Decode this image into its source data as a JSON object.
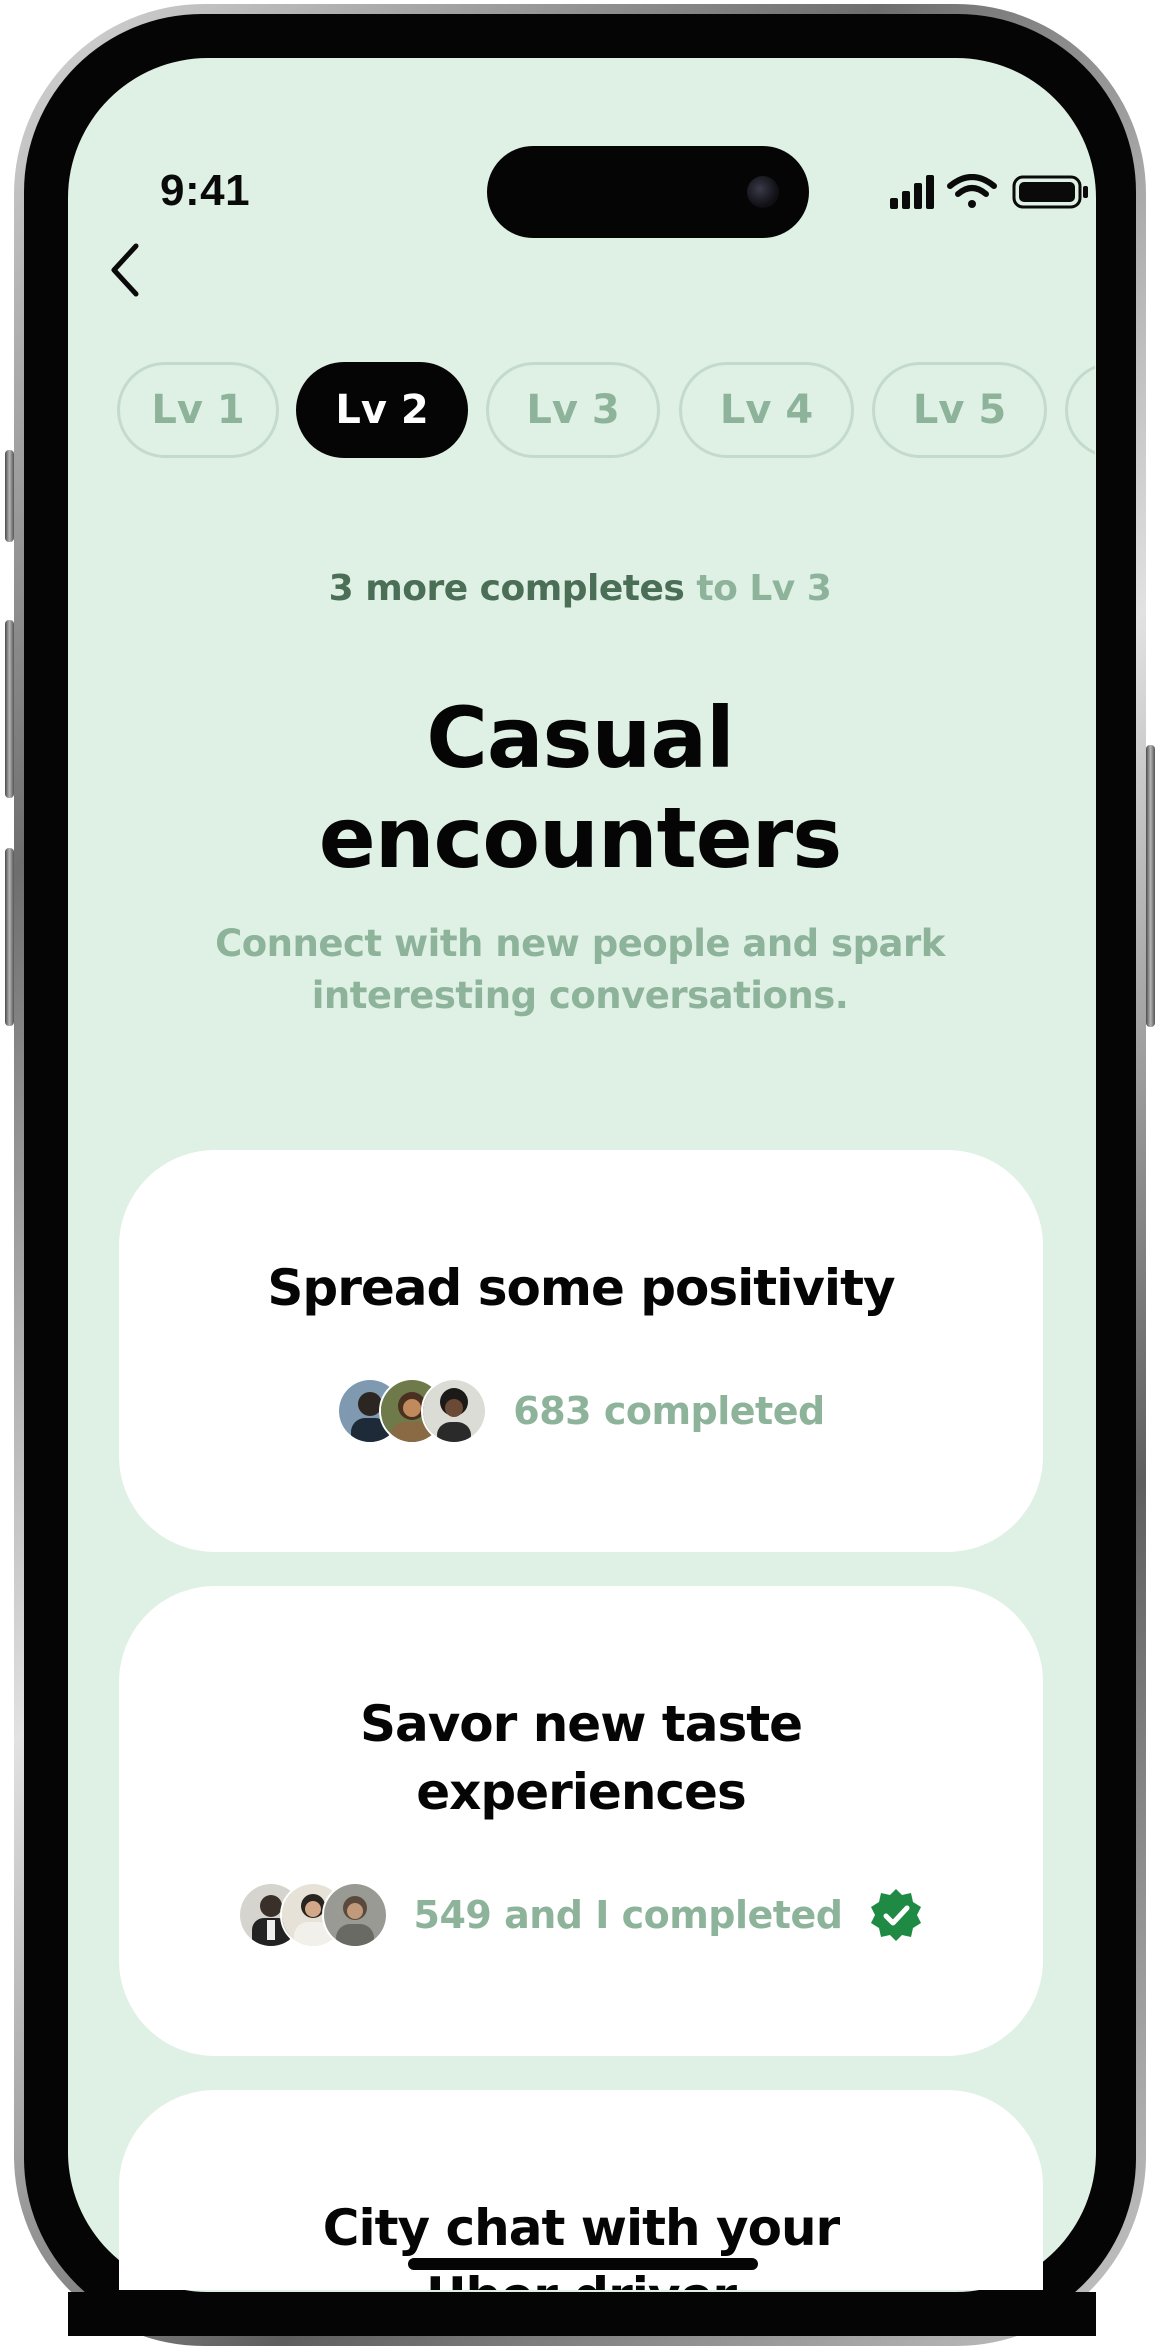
{
  "status_bar": {
    "time": "9:41"
  },
  "nav": {
    "back_icon": "chevron-left-icon"
  },
  "levels": [
    {
      "label": "Lv 1",
      "active": false
    },
    {
      "label": "Lv 2",
      "active": true
    },
    {
      "label": "Lv 3",
      "active": false
    },
    {
      "label": "Lv 4",
      "active": false
    },
    {
      "label": "Lv 5",
      "active": false
    },
    {
      "label": "",
      "active": false
    }
  ],
  "progress": {
    "strong": "3 more completes",
    "muted": "to Lv 3"
  },
  "header": {
    "title_line1": "Casual",
    "title_line2": "encounters",
    "subtitle_line1": "Connect with new people and spark",
    "subtitle_line2": "interesting conversations."
  },
  "cards": [
    {
      "title_line1": "Spread some positivity",
      "title_line2": "",
      "meta": "683 completed",
      "verified": false
    },
    {
      "title_line1": "Savor new taste",
      "title_line2": "experiences",
      "meta": "549 and I completed",
      "verified": true
    },
    {
      "title_line1": "City chat with your",
      "title_line2": "Uber driver",
      "meta": "",
      "verified": false
    }
  ],
  "colors": {
    "background": "#dff0e5",
    "accent_muted": "#8db39a",
    "accent_dark": "#4b6e56",
    "verified_green": "#1f8a43",
    "active_pill": "#050505"
  }
}
